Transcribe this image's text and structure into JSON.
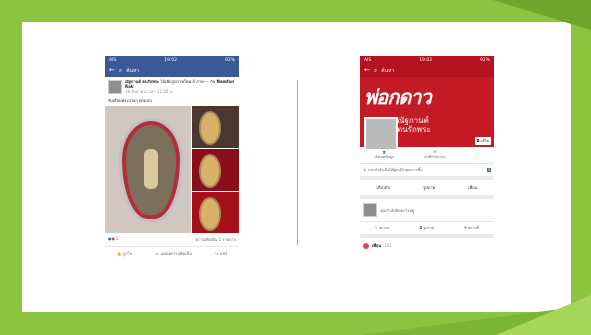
{
  "left_phone": {
    "status_carrier": "AIS",
    "status_time": "19:02",
    "status_battery": "92%",
    "search_placeholder": "ค้นหา",
    "author": "ณัฐกานต์ ตนรักพระ",
    "post_action": "ได้เพิ่มรูปภาพใหม่ 4 ภาพ",
    "with_label": "— กับ",
    "tagged": "Namfon Rak",
    "date": "18 สิงหาคม เวลา 21:50 น.",
    "caption": "รับเลี่ยมพระสวยๆ ทุกเเบบ",
    "reaction_count": "2",
    "comment_count": "ความคิดเห็น 1 รายการ",
    "like": "ถูกใจ",
    "comment": "แสดงความคิดเห็น",
    "share": "แชร์"
  },
  "right_phone": {
    "status_carrier": "AIS",
    "status_time": "19:02",
    "status_battery": "92%",
    "search_placeholder": "ค้นหา",
    "cover_text": "พ่อกดาว",
    "name_line1": "ณัฐกานต์",
    "name_line2": "ตนรักพระ",
    "edit_cover": "แก้ไข",
    "edit_pic": "แก้ไข",
    "action_profile": "อัพเดตข้อมูล",
    "action_log": "บันทึกกิจกรรม",
    "action_more": "...",
    "intro_text": "แนะนำตัวเพื่อให้ผู้คนรู้จักคุณมากขึ้น",
    "intro_badge": "5",
    "tab_about": "เกี่ยวกับ",
    "tab_photos": "รูปภาพ",
    "tab_friends": "เพื่อน",
    "composer_placeholder": "คุณกำลังคิดอะไรอยู่",
    "composer_live": "สถานะ",
    "composer_photo": "รูปภาพ",
    "composer_checkin": "สถานที่",
    "friends_label": "เพื่อน",
    "friends_count": "101"
  }
}
